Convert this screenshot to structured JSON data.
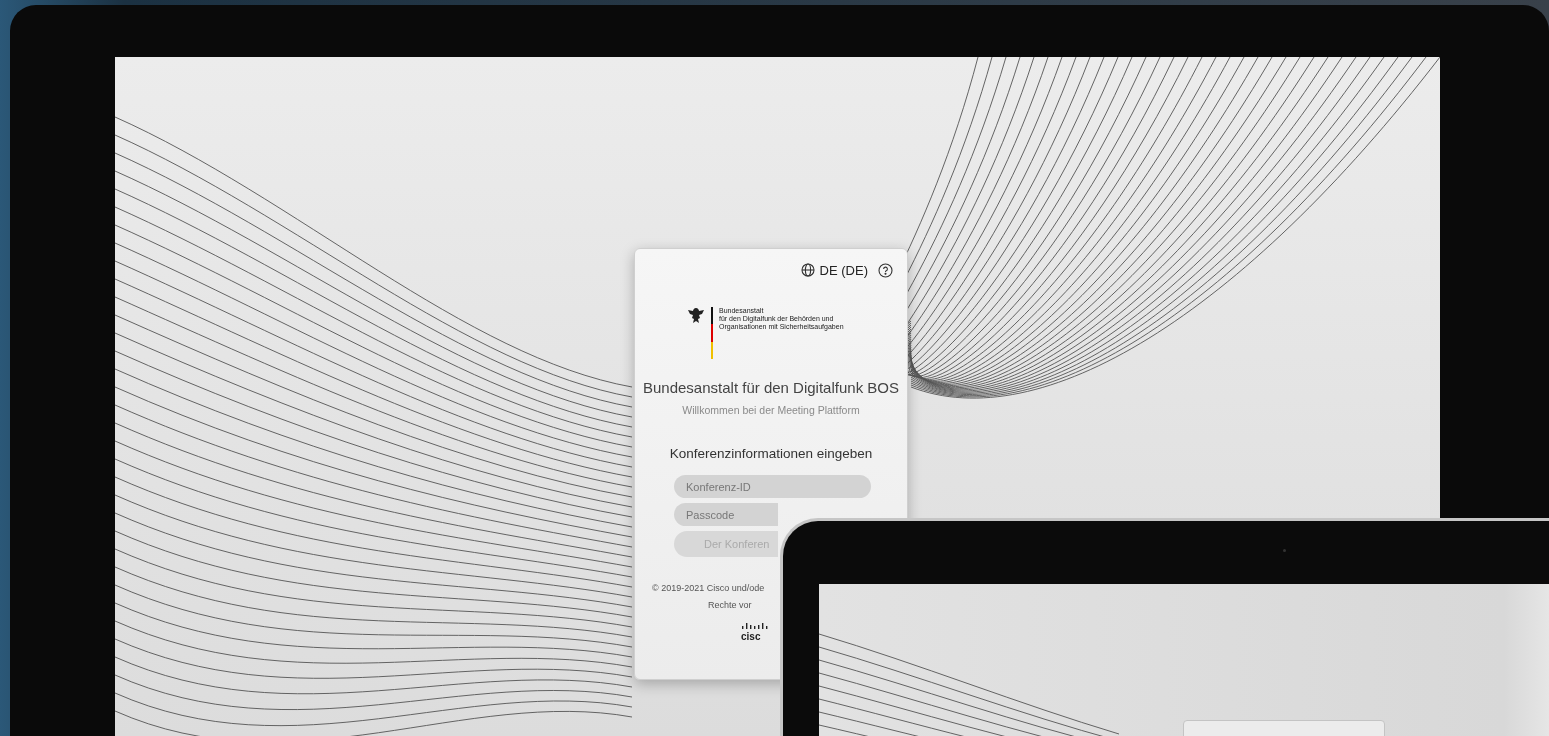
{
  "header": {
    "language": "DE (DE)"
  },
  "logo": {
    "lines": [
      "Bundesanstalt",
      "für den Digitalfunk der Behörden und",
      "Organisationen mit Sicherheitsaufgaben"
    ]
  },
  "title": "Bundesanstalt für den Digitalfunk BOS",
  "subtitle": "Willkommen bei der Meeting Plattform",
  "form": {
    "heading": "Konferenzinformationen eingeben",
    "fields": [
      {
        "placeholder": "Konferenz-ID"
      },
      {
        "placeholder": "Passcode"
      }
    ],
    "button": {
      "label": "Der Konferen",
      "disabled": true
    }
  },
  "footer": {
    "copyright": "© 2019-2021 Cisco und/ode",
    "rights": "Rechte vor",
    "brand": "cisc"
  }
}
